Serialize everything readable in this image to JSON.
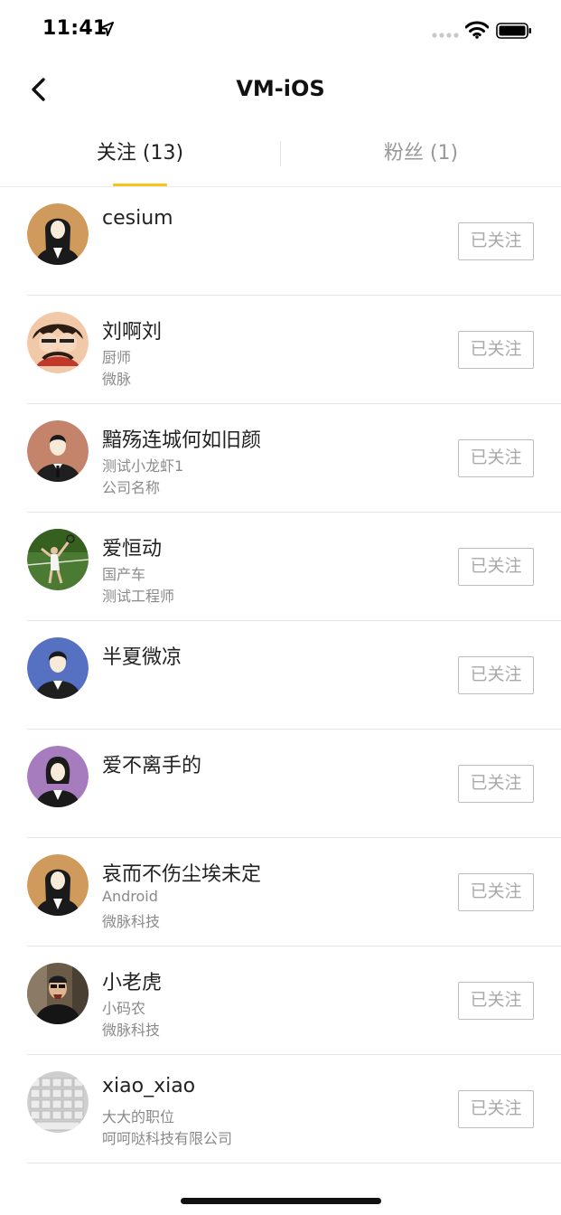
{
  "status_bar": {
    "time": "11:41"
  },
  "nav": {
    "title": "VM-iOS"
  },
  "tabs": [
    {
      "label": "关注 (13)",
      "active": true
    },
    {
      "label": "粉丝 (1)",
      "active": false
    }
  ],
  "colors": {
    "accent": "#f5c518",
    "muted_text": "#8a8a8a",
    "button_border": "#bdbdbd"
  },
  "users": [
    {
      "name": "cesium",
      "title": "",
      "company": "",
      "avatar": "female-avatar",
      "avatar_color": "#cf9a5c",
      "button": "已关注"
    },
    {
      "name": "刘啊刘",
      "title": "厨师",
      "company": "微脉",
      "avatar": "cartoon-photo-avatar",
      "avatar_color": "#e9a07a",
      "button": "已关注"
    },
    {
      "name": "黯殇连城何如旧颜",
      "title": "测试小龙虾1",
      "company": "公司名称",
      "avatar": "male-avatar",
      "avatar_color": "#c4836b",
      "button": "已关注"
    },
    {
      "name": "爱恒动",
      "title": "国产车",
      "company": "测试工程师",
      "avatar": "tennis-photo-avatar",
      "avatar_color": "#4b7a33",
      "button": "已关注"
    },
    {
      "name": "半夏微凉",
      "title": "",
      "company": "",
      "avatar": "male-avatar",
      "avatar_color": "#5670c2",
      "button": "已关注"
    },
    {
      "name": "爱不离手的",
      "title": "",
      "company": "",
      "avatar": "female-avatar",
      "avatar_color": "#a77cbf",
      "button": "已关注"
    },
    {
      "name": "哀而不伤尘埃未定",
      "title": "Android",
      "company": "微脉科技",
      "avatar": "female-avatar",
      "avatar_color": "#cf9a5c",
      "button": "已关注"
    },
    {
      "name": "小老虎",
      "title": "小码农",
      "company": "微脉科技",
      "avatar": "person-photo-avatar",
      "avatar_color": "#6a5a48",
      "button": "已关注"
    },
    {
      "name": "xiao_xiao",
      "title": "大大的职位",
      "company": "呵呵哒科技有限公司",
      "avatar": "keyboard-photo-avatar",
      "avatar_color": "#cfcfcf",
      "button": "已关注"
    }
  ]
}
